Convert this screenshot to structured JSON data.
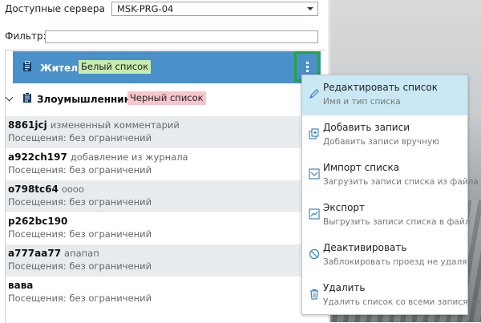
{
  "server": {
    "label": "Доступные сервера",
    "value": "MSK-PRG-04"
  },
  "filter": {
    "label": "Фильтр:",
    "value": ""
  },
  "groups": [
    {
      "title": "Жители",
      "tag": "Белый список"
    },
    {
      "title": "Злоумышленники",
      "tag": "Черный список"
    }
  ],
  "entries": [
    {
      "name": "8861jcj",
      "comment": "измененный комментарий",
      "visits": "Посещения: без ограничений"
    },
    {
      "name": "a922ch197",
      "comment": "добавление из журнала",
      "visits": "Посещения: без ограничений"
    },
    {
      "name": "o798tc64",
      "comment": "оооо",
      "visits": "Посещения: без ограничений"
    },
    {
      "name": "p262bc190",
      "comment": "",
      "visits": "Посещения: без ограничений"
    },
    {
      "name": "a777aa77",
      "comment": "апапап",
      "visits": "Посещения: без ограничений"
    },
    {
      "name": "вава",
      "comment": "",
      "visits": "Посещения: без ограничений"
    }
  ],
  "menu": [
    {
      "title": "Редактировать список",
      "subtitle": "Имя и тип списка",
      "icon": "pencil-icon"
    },
    {
      "title": "Добавить записи",
      "subtitle": "Добавить записи вручную",
      "icon": "add-records-icon"
    },
    {
      "title": "Импорт списка",
      "subtitle": "Загрузить записи списка из файла",
      "icon": "import-icon"
    },
    {
      "title": "Экспорт",
      "subtitle": "Выгрузить записи списка в файл",
      "icon": "export-icon"
    },
    {
      "title": "Деактивировать",
      "subtitle": "Заблокировать проезд не удаляя",
      "icon": "block-icon"
    },
    {
      "title": "Удалить",
      "subtitle": "Удалить список со всеми записями",
      "icon": "trash-icon"
    }
  ],
  "colors": {
    "header_blue": "#4a90c9",
    "highlight_box": "#22a63b",
    "menu_hover": "#c9e8f3",
    "tag_white_list": "#c9ecae",
    "tag_black_list": "#f7c5cc"
  }
}
